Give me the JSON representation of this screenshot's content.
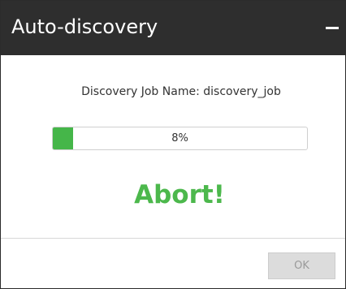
{
  "window": {
    "title": "Auto-discovery",
    "minimize_icon": "minimize-icon"
  },
  "body": {
    "job_label": "Discovery Job Name: discovery_job",
    "progress": {
      "percent": 8,
      "label": "8%",
      "fill_color": "#45b649"
    },
    "status_text": "Abort!",
    "status_color": "#4cb84c"
  },
  "footer": {
    "ok_label": "OK",
    "ok_enabled": false
  }
}
